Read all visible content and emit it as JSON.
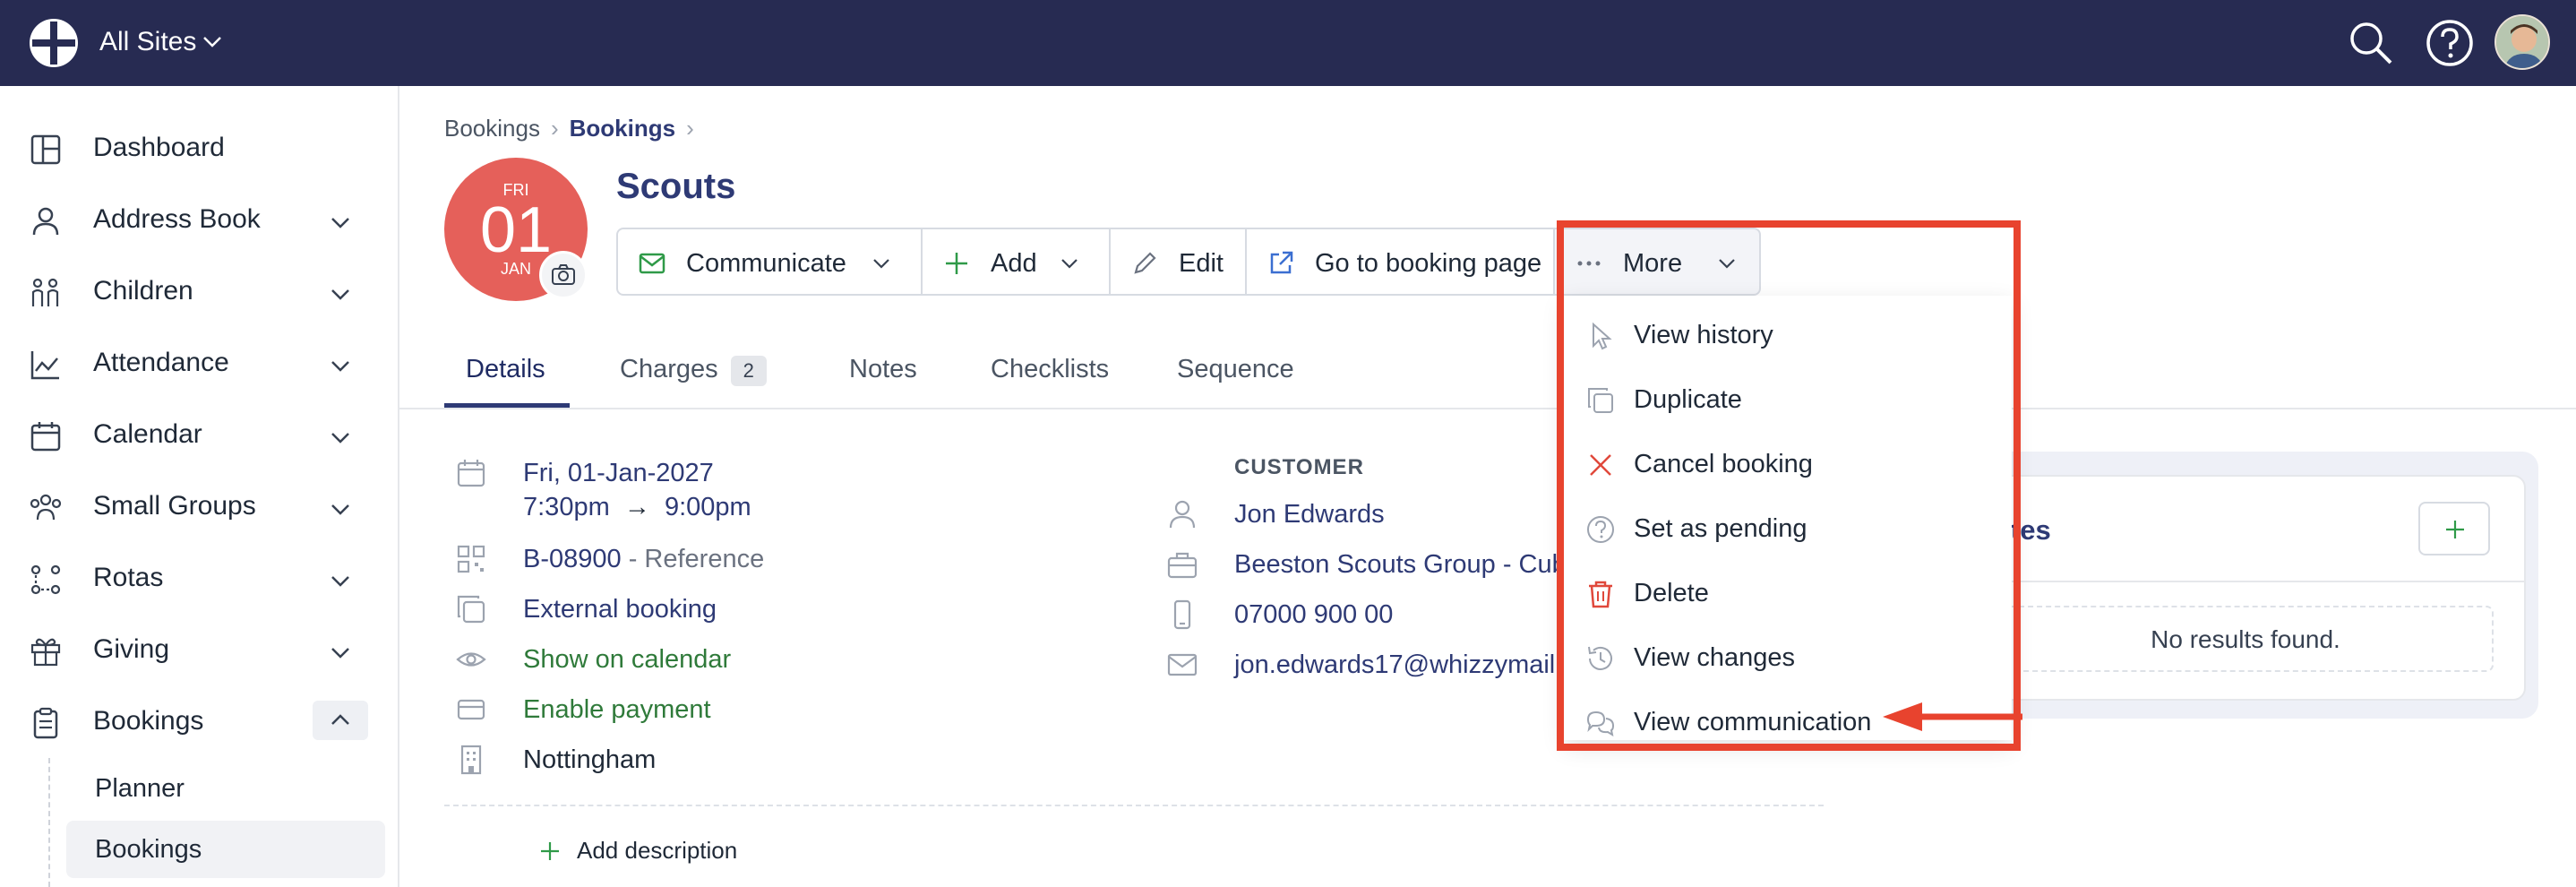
{
  "topbar": {
    "site_name": "All Sites",
    "icons": [
      "logo-icon",
      "chevron-down-icon",
      "search-icon",
      "help-icon",
      "avatar"
    ]
  },
  "sidebar": {
    "items": [
      {
        "label": "Dashboard",
        "icon": "dashboard-icon"
      },
      {
        "label": "Address Book",
        "icon": "person-icon"
      },
      {
        "label": "Children",
        "icon": "children-icon"
      },
      {
        "label": "Attendance",
        "icon": "chart-icon"
      },
      {
        "label": "Calendar",
        "icon": "calendar-icon"
      },
      {
        "label": "Small Groups",
        "icon": "group-icon"
      },
      {
        "label": "Rotas",
        "icon": "rota-icon"
      },
      {
        "label": "Giving",
        "icon": "gift-icon"
      },
      {
        "label": "Bookings",
        "icon": "clipboard-icon"
      }
    ],
    "sub_items": [
      {
        "label": "Planner"
      },
      {
        "label": "Bookings"
      }
    ]
  },
  "breadcrumb": {
    "items": [
      "Bookings",
      "Bookings"
    ]
  },
  "date_badge": {
    "day": "FRI",
    "number": "01",
    "month": "JAN"
  },
  "page": {
    "title": "Scouts"
  },
  "toolbar": {
    "communicate": "Communicate",
    "add": "Add",
    "edit": "Edit",
    "go_to_booking": "Go to booking page",
    "more": "More"
  },
  "tabs": {
    "details": "Details",
    "charges": "Charges",
    "charges_count": "2",
    "notes": "Notes",
    "checklists": "Checklists",
    "sequence": "Sequence"
  },
  "details": {
    "date": "Fri, 01-Jan-2027",
    "time_start": "7:30pm",
    "time_arrow": "→",
    "time_end": "9:00pm",
    "reference_code": "B-08900",
    "reference_label": " - Reference",
    "external": "External booking",
    "show_calendar": "Show on calendar",
    "enable_payment": "Enable payment",
    "location": "Nottingham"
  },
  "customer": {
    "heading": "CUSTOMER",
    "name": "Jon Edwards",
    "group": "Beeston Scouts Group - Cub",
    "phone": "07000 900 00",
    "email": "jon.edwards17@whizzymail"
  },
  "add_description": "Add description",
  "notes_panel": {
    "title": "otes",
    "add_label": "+",
    "empty": "No results found."
  },
  "more_menu": {
    "items": [
      {
        "label": "View history",
        "icon": "cursor-icon"
      },
      {
        "label": "Duplicate",
        "icon": "duplicate-icon"
      },
      {
        "label": "Cancel booking",
        "icon": "close-icon"
      },
      {
        "label": "Set as pending",
        "icon": "question-icon"
      },
      {
        "label": "Delete",
        "icon": "trash-icon"
      },
      {
        "label": "View changes",
        "icon": "history-icon"
      },
      {
        "label": "View communication",
        "icon": "chat-icon"
      }
    ]
  },
  "colors": {
    "topbar": "#272b52",
    "accent": "#2e3a75",
    "date_badge": "#e5605a",
    "highlight": "#e8432e",
    "green": "#2f7a3a"
  }
}
